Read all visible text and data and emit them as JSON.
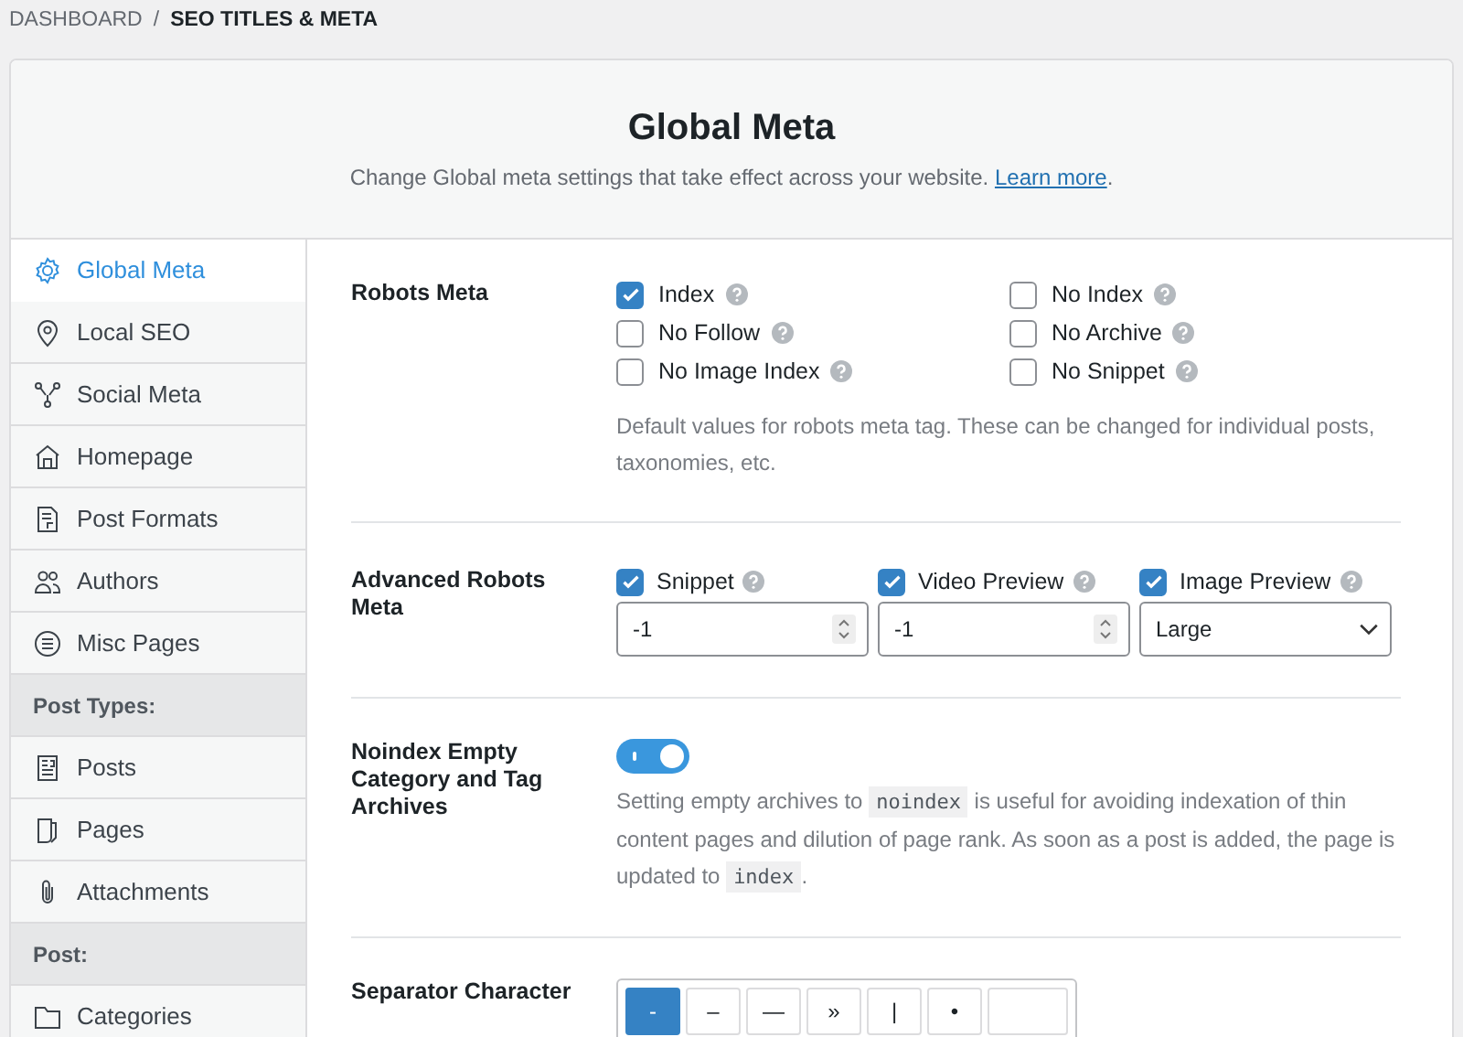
{
  "breadcrumb": {
    "parent": "DASHBOARD",
    "separator": "/",
    "current": "SEO TITLES & META"
  },
  "header": {
    "title": "Global Meta",
    "description": "Change Global meta settings that take effect across your website.",
    "link": "Learn more",
    "after_link": "."
  },
  "sidebar": {
    "items": [
      {
        "kind": "item",
        "label": "Global Meta",
        "selected": true
      },
      {
        "kind": "item",
        "label": "Local SEO",
        "selected": false
      },
      {
        "kind": "item",
        "label": "Social Meta",
        "selected": false
      },
      {
        "kind": "item",
        "label": "Homepage",
        "selected": false
      },
      {
        "kind": "item",
        "label": "Post Formats",
        "selected": false
      },
      {
        "kind": "item",
        "label": "Authors",
        "selected": false
      },
      {
        "kind": "item",
        "label": "Misc Pages",
        "selected": false
      },
      {
        "kind": "heading",
        "label": "Post Types:"
      },
      {
        "kind": "item",
        "label": "Posts",
        "selected": false
      },
      {
        "kind": "item",
        "label": "Pages",
        "selected": false
      },
      {
        "kind": "item",
        "label": "Attachments",
        "selected": false
      },
      {
        "kind": "heading",
        "label": "Post:"
      },
      {
        "kind": "item",
        "label": "Categories",
        "selected": false
      }
    ]
  },
  "robots_meta": {
    "label": "Robots Meta",
    "options": [
      {
        "label": "Index",
        "checked": true
      },
      {
        "label": "No Index",
        "checked": false
      },
      {
        "label": "No Follow",
        "checked": false
      },
      {
        "label": "No Archive",
        "checked": false
      },
      {
        "label": "No Image Index",
        "checked": false
      },
      {
        "label": "No Snippet",
        "checked": false
      }
    ],
    "description": "Default values for robots meta tag. These can be changed for individual posts, taxonomies, etc."
  },
  "advanced_robots_meta": {
    "label": "Advanced Robots Meta",
    "fields": [
      {
        "kind": "number",
        "label": "Snippet",
        "checked": true,
        "value": "-1"
      },
      {
        "kind": "number",
        "label": "Video Preview",
        "checked": true,
        "value": "-1"
      },
      {
        "kind": "select",
        "label": "Image Preview",
        "checked": true,
        "value": "Large"
      }
    ]
  },
  "noindex_empty": {
    "label": "Noindex Empty Category and Tag Archives",
    "on": true,
    "description": [
      {
        "kind": "text",
        "text": "Setting empty archives to "
      },
      {
        "kind": "code",
        "text": "noindex"
      },
      {
        "kind": "text",
        "text": " is useful for avoiding indexation of thin content pages and dilution of page rank. As soon as a post is added, the page is updated to "
      },
      {
        "kind": "code",
        "text": "index"
      },
      {
        "kind": "text",
        "text": "."
      }
    ]
  },
  "separator_character": {
    "label": "Separator Character",
    "options": [
      {
        "kind": "char",
        "label": "-",
        "selected": true
      },
      {
        "kind": "char",
        "label": "–",
        "selected": false
      },
      {
        "kind": "char",
        "label": "—",
        "selected": false
      },
      {
        "kind": "char",
        "label": "»",
        "selected": false
      },
      {
        "kind": "char",
        "label": "|",
        "selected": false
      },
      {
        "kind": "char",
        "label": "•",
        "selected": false
      },
      {
        "kind": "custom",
        "selected": false
      }
    ]
  }
}
